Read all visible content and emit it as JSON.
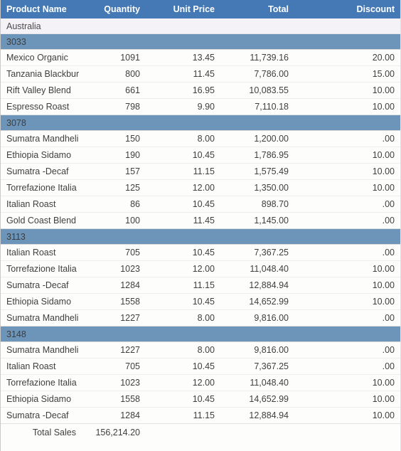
{
  "table": {
    "columns": [
      {
        "key": "product_name",
        "label": "Product Name",
        "align": "left"
      },
      {
        "key": "quantity",
        "label": "Quantity",
        "align": "right"
      },
      {
        "key": "unit_price",
        "label": "Unit Price",
        "align": "right"
      },
      {
        "key": "total",
        "label": "Total",
        "align": "right"
      },
      {
        "key": "discount",
        "label": "Discount",
        "align": "right"
      }
    ],
    "country": "Australia",
    "groups": [
      {
        "id": "3033",
        "rows": [
          {
            "product_name": "Mexico Organic",
            "quantity": "1091",
            "unit_price": "13.45",
            "total": "11,739.16",
            "discount": "20.00"
          },
          {
            "product_name": "Tanzania Blackbur",
            "quantity": "800",
            "unit_price": "11.45",
            "total": "7,786.00",
            "discount": "15.00"
          },
          {
            "product_name": "Rift Valley Blend",
            "quantity": "661",
            "unit_price": "16.95",
            "total": "10,083.55",
            "discount": "10.00"
          },
          {
            "product_name": "Espresso Roast",
            "quantity": "798",
            "unit_price": "9.90",
            "total": "7,110.18",
            "discount": "10.00"
          }
        ]
      },
      {
        "id": "3078",
        "rows": [
          {
            "product_name": "Sumatra Mandheli",
            "quantity": "150",
            "unit_price": "8.00",
            "total": "1,200.00",
            "discount": ".00"
          },
          {
            "product_name": "Ethiopia Sidamo",
            "quantity": "190",
            "unit_price": "10.45",
            "total": "1,786.95",
            "discount": "10.00"
          },
          {
            "product_name": "Sumatra -Decaf",
            "quantity": "157",
            "unit_price": "11.15",
            "total": "1,575.49",
            "discount": "10.00"
          },
          {
            "product_name": "Torrefazione Italia",
            "quantity": "125",
            "unit_price": "12.00",
            "total": "1,350.00",
            "discount": "10.00"
          },
          {
            "product_name": "Italian Roast",
            "quantity": "86",
            "unit_price": "10.45",
            "total": "898.70",
            "discount": ".00"
          },
          {
            "product_name": "Gold Coast Blend",
            "quantity": "100",
            "unit_price": "11.45",
            "total": "1,145.00",
            "discount": ".00"
          }
        ]
      },
      {
        "id": "3113",
        "rows": [
          {
            "product_name": "Italian Roast",
            "quantity": "705",
            "unit_price": "10.45",
            "total": "7,367.25",
            "discount": ".00"
          },
          {
            "product_name": "Torrefazione Italia",
            "quantity": "1023",
            "unit_price": "12.00",
            "total": "11,048.40",
            "discount": "10.00"
          },
          {
            "product_name": "Sumatra -Decaf",
            "quantity": "1284",
            "unit_price": "11.15",
            "total": "12,884.94",
            "discount": "10.00"
          },
          {
            "product_name": "Ethiopia Sidamo",
            "quantity": "1558",
            "unit_price": "10.45",
            "total": "14,652.99",
            "discount": "10.00"
          },
          {
            "product_name": "Sumatra Mandheli",
            "quantity": "1227",
            "unit_price": "8.00",
            "total": "9,816.00",
            "discount": ".00"
          }
        ]
      },
      {
        "id": "3148",
        "rows": [
          {
            "product_name": "Sumatra Mandheli",
            "quantity": "1227",
            "unit_price": "8.00",
            "total": "9,816.00",
            "discount": ".00"
          },
          {
            "product_name": "Italian Roast",
            "quantity": "705",
            "unit_price": "10.45",
            "total": "7,367.25",
            "discount": ".00"
          },
          {
            "product_name": "Torrefazione Italia",
            "quantity": "1023",
            "unit_price": "12.00",
            "total": "11,048.40",
            "discount": "10.00"
          },
          {
            "product_name": "Ethiopia Sidamo",
            "quantity": "1558",
            "unit_price": "10.45",
            "total": "14,652.99",
            "discount": "10.00"
          },
          {
            "product_name": "Sumatra -Decaf",
            "quantity": "1284",
            "unit_price": "11.15",
            "total": "12,884.94",
            "discount": "10.00"
          }
        ]
      }
    ],
    "footer": {
      "label": "Total Sales",
      "value": "156,214.20"
    }
  },
  "colors": {
    "header_background": "#4479b5",
    "header_text": "#ffffff",
    "group_background": "#6d95b9",
    "country_background": "#f4f2f6",
    "row_background": "#fdfdfb",
    "row_divider": "#ededed",
    "body_text": "#3f3f3f"
  }
}
